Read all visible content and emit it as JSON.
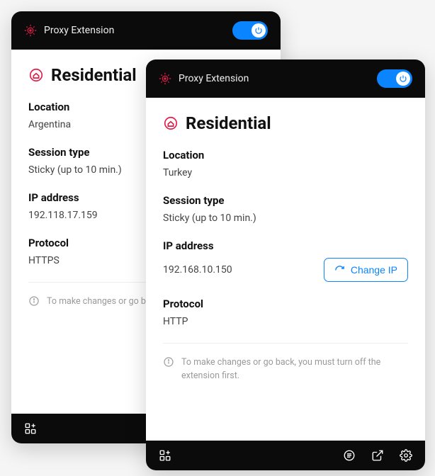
{
  "app": {
    "title": "Proxy Extension",
    "accent": "#0a84ff",
    "danger": "#e11d48"
  },
  "panel_back": {
    "proxy_type": "Residential",
    "fields": {
      "location_label": "Location",
      "location_value": "Argentina",
      "session_label": "Session type",
      "session_value": "Sticky (up to 10 min.)",
      "ip_label": "IP address",
      "ip_value": "192.118.17.159",
      "protocol_label": "Protocol",
      "protocol_value": "HTTPS"
    },
    "note": "To make changes or go back, first."
  },
  "panel_front": {
    "proxy_type": "Residential",
    "fields": {
      "location_label": "Location",
      "location_value": "Turkey",
      "session_label": "Session type",
      "session_value": "Sticky (up to 10 min.)",
      "ip_label": "IP address",
      "ip_value": "192.168.10.150",
      "protocol_label": "Protocol",
      "protocol_value": "HTTP"
    },
    "change_ip_label": "Change IP",
    "note": "To make changes or go back, you must turn off the extension first."
  }
}
